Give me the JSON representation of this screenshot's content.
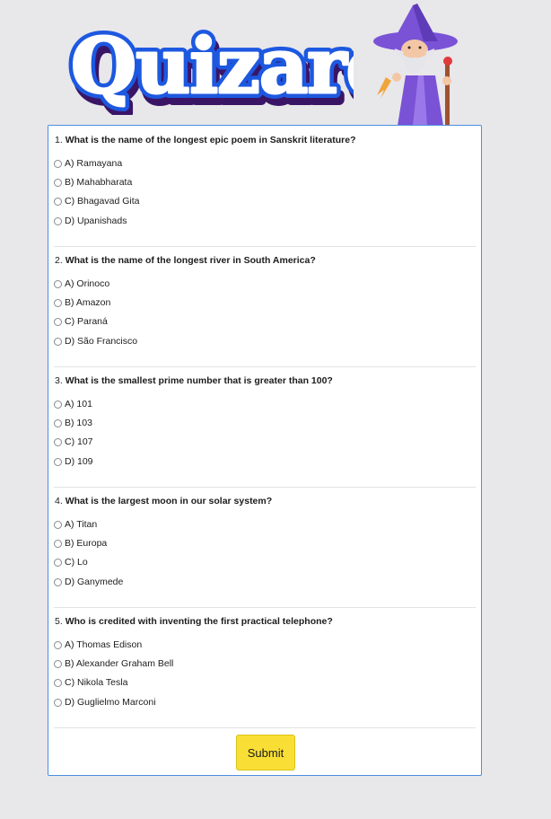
{
  "brand": {
    "logo_text": "Quizards",
    "mascot_icon": "wizard-icon"
  },
  "colors": {
    "logo_fill": "#ffffff",
    "logo_stroke": "#1d58e0",
    "logo_shadow": "#3a1566",
    "card_border": "#4b8fe0",
    "submit_bg": "#f9df35"
  },
  "questions": [
    {
      "number": "1.",
      "text": "What is the name of the longest epic poem in Sanskrit literature?",
      "options": [
        "A) Ramayana",
        "B) Mahabharata",
        "C) Bhagavad Gita",
        "D) Upanishads"
      ]
    },
    {
      "number": "2.",
      "text": "What is the name of the longest river in South America?",
      "options": [
        "A) Orinoco",
        "B) Amazon",
        "C) Paraná",
        "D) São Francisco"
      ]
    },
    {
      "number": "3.",
      "text": "What is the smallest prime number that is greater than 100?",
      "options": [
        "A) 101",
        "B) 103",
        "C) 107",
        "D) 109"
      ]
    },
    {
      "number": "4.",
      "text": "What is the largest moon in our solar system?",
      "options": [
        "A) Titan",
        "B) Europa",
        "C) Lo",
        "D) Ganymede"
      ]
    },
    {
      "number": "5.",
      "text": "Who is credited with inventing the first practical telephone?",
      "options": [
        "A) Thomas Edison",
        "B) Alexander Graham Bell",
        "C) Nikola Tesla",
        "D) Guglielmo Marconi"
      ]
    }
  ],
  "submit_label": "Submit"
}
